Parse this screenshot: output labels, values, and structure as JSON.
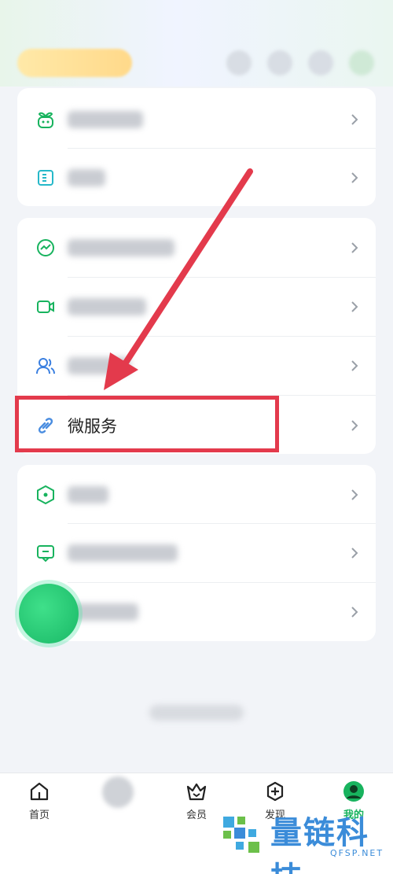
{
  "menu": {
    "highlighted_item": {
      "label": "微服务"
    }
  },
  "tabbar": {
    "tabs": [
      {
        "label": "首页",
        "icon": "home-icon"
      },
      {
        "label": "会员",
        "icon": "vip-crown-icon"
      },
      {
        "label": "发现",
        "icon": "discover-plus-icon"
      },
      {
        "label": "我的",
        "icon": "profile-avatar-icon",
        "active": true
      }
    ]
  },
  "watermark": {
    "text": "量链科技",
    "sub": "QFSP.NET"
  },
  "colors": {
    "accent_green": "#18b35e",
    "highlight_red": "#e33a4c",
    "watermark_blue": "#3b8cd9"
  }
}
